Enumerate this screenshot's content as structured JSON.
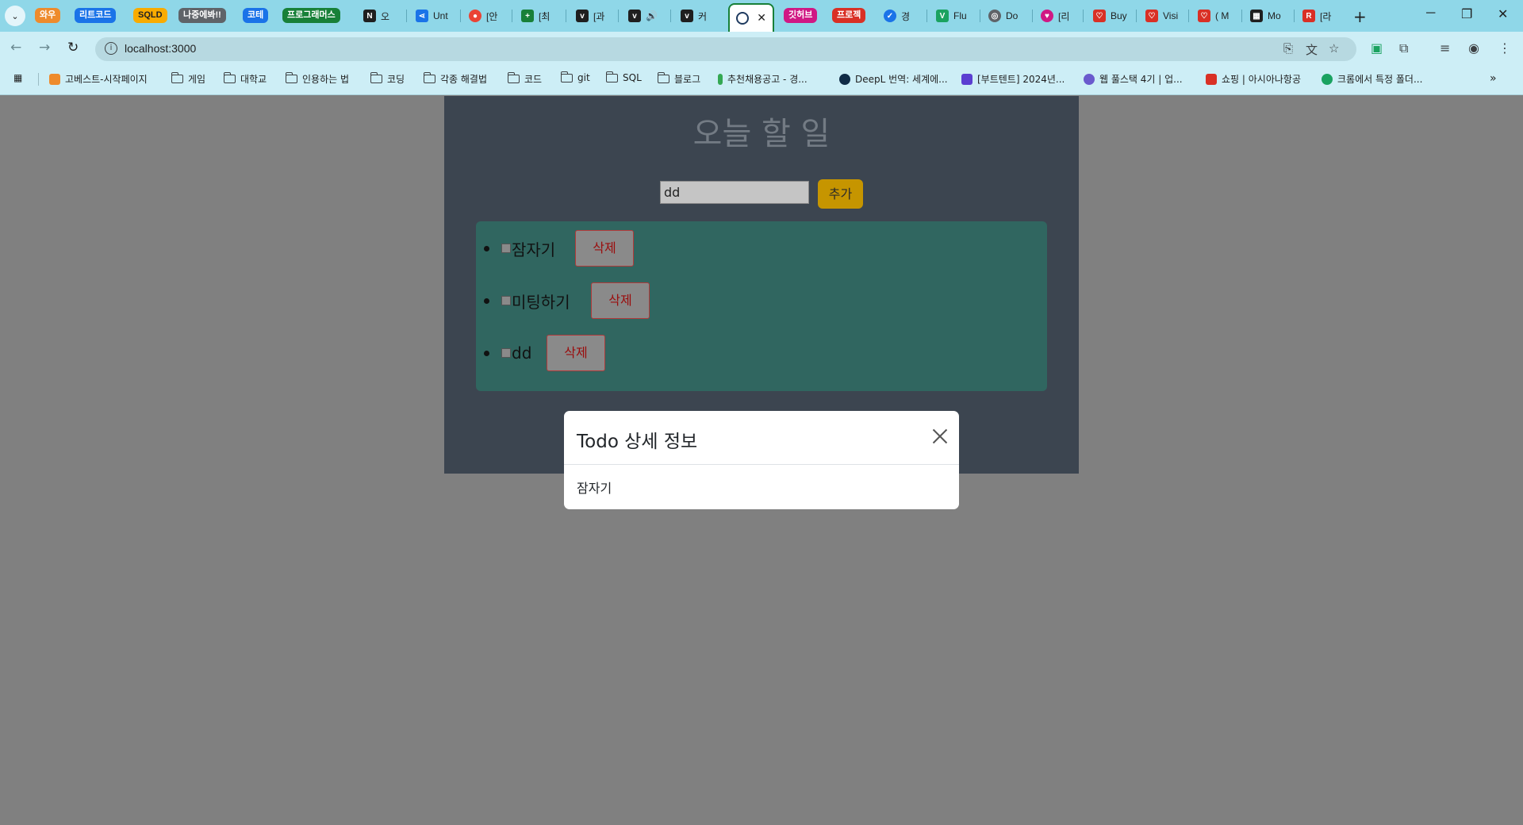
{
  "browser": {
    "tab_groups": [
      {
        "label": "와우",
        "color": "#ee8b2c"
      },
      {
        "label": "리트코드",
        "color": "#1a73e8"
      },
      {
        "label": "SQLD",
        "color": "#f9ab00"
      },
      {
        "label": "나중에봐!!",
        "color": "#5f6368"
      },
      {
        "label": "코테",
        "color": "#1a73e8"
      },
      {
        "label": "프로그래머스",
        "color": "#188038"
      },
      {
        "label": "깃허브",
        "color": "#d01884"
      },
      {
        "label": "프로젝",
        "color": "#d93025"
      }
    ],
    "tabs": [
      {
        "label": "오",
        "icon": "notion-icon",
        "color": "#1f1f1f"
      },
      {
        "label": "Unt",
        "icon": "share-icon",
        "color": "#1a73e8"
      },
      {
        "label": "[안",
        "icon": "red-circle-icon",
        "color": "#ea4335"
      },
      {
        "label": "[최",
        "icon": "plus-icon",
        "color": "#188038"
      },
      {
        "label": "[과",
        "icon": "velog-icon",
        "color": "#1f1f1f"
      },
      {
        "label": "",
        "icon": "velog-icon",
        "color": "#1f1f1f"
      },
      {
        "label": "커",
        "icon": "velog-icon",
        "color": "#1f1f1f"
      },
      {
        "label": "경",
        "icon": "check-icon",
        "color": "#1a73e8"
      },
      {
        "label": "Flu",
        "icon": "vue-icon",
        "color": "#1aa260"
      },
      {
        "label": "Do",
        "icon": "globe-icon",
        "color": "#5f6368"
      },
      {
        "label": "[리",
        "icon": "heart-icon",
        "color": "#d01884"
      },
      {
        "label": "Buy",
        "icon": "shield-heart-icon",
        "color": "#d93025"
      },
      {
        "label": "Visi",
        "icon": "shield-heart-icon",
        "color": "#d93025"
      },
      {
        "label": "( M",
        "icon": "shield-heart-icon",
        "color": "#d93025"
      },
      {
        "label": "Mo",
        "icon": "grid-icon",
        "color": "#1f1f1f"
      },
      {
        "label": "[라",
        "icon": "r-icon",
        "color": "#d93025"
      }
    ],
    "active_tab_close": "✕",
    "new_tab": "+",
    "url": "localhost:3000",
    "bookmarks": [
      {
        "label": "고베스트-시작페이지",
        "type": "site",
        "color": "#ee8b2c"
      },
      {
        "label": "게임",
        "type": "folder"
      },
      {
        "label": "대학교",
        "type": "folder"
      },
      {
        "label": "인용하는 법",
        "type": "folder"
      },
      {
        "label": "코딩",
        "type": "folder"
      },
      {
        "label": "각종 해결법",
        "type": "folder"
      },
      {
        "label": "코드",
        "type": "folder"
      },
      {
        "label": "git",
        "type": "folder"
      },
      {
        "label": "SQL",
        "type": "folder"
      },
      {
        "label": "블로그",
        "type": "folder"
      },
      {
        "label": "추천채용공고 - 경...",
        "type": "site",
        "color": "#34a853"
      },
      {
        "label": "DeepL 번역: 세계에...",
        "type": "site",
        "color": "#0f2b46"
      },
      {
        "label": "[부트텐트] 2024년...",
        "type": "site",
        "color": "#5b3fd1"
      },
      {
        "label": "웹 풀스택 4기 | 업...",
        "type": "site",
        "color": "#6a5acd"
      },
      {
        "label": "쇼핑 | 아시아나항공",
        "type": "site",
        "color": "#d93025"
      },
      {
        "label": "크롬에서 특정 폴더...",
        "type": "site",
        "color": "#1aa260"
      }
    ]
  },
  "app": {
    "title": "오늘 할 일",
    "input_value": "dd",
    "add_label": "추가",
    "todos": [
      {
        "text": "잠자기",
        "delete_label": "삭제"
      },
      {
        "text": "미팅하기",
        "delete_label": "삭제"
      },
      {
        "text": "dd",
        "delete_label": "삭제"
      }
    ]
  },
  "modal": {
    "title": "Todo 상세 정보",
    "body": "잠자기"
  }
}
